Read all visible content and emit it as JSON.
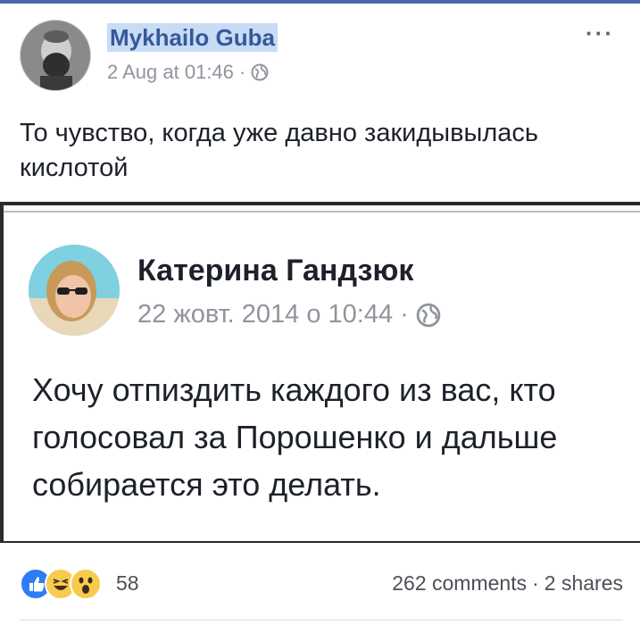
{
  "post": {
    "author": "Mykhailo Guba",
    "date": "2 Aug at 01:46",
    "separator": "·",
    "privacy_icon": "globe-icon",
    "more_label": "···",
    "text": "То чувство, когда уже давно закидывылась кислотой"
  },
  "shared": {
    "author": "Катерина Гандзюк",
    "date": "22 жовт. 2014 о 10:44",
    "separator": "·",
    "privacy_icon": "globe-icon",
    "text": "Хочу отпиздить каждого из вас, кто голосовал за Порошенко и дальше собирается это делать."
  },
  "footer": {
    "reaction_icons": [
      "like-icon",
      "haha-icon",
      "wow-icon"
    ],
    "reaction_count": "58",
    "comments": "262 comments",
    "separator": "·",
    "shares": "2 shares"
  },
  "colors": {
    "link_blue": "#365899",
    "meta_gray": "#90949c",
    "like_blue": "#2e7cf6",
    "emoji_yellow": "#f7cb4d"
  }
}
